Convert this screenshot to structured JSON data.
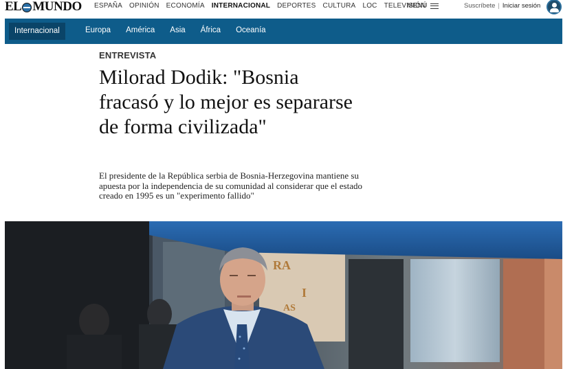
{
  "header": {
    "logo_left": "EL",
    "logo_right": "MUNDO",
    "nav": [
      "ESPAÑA",
      "OPINIÓN",
      "ECONOMÍA",
      "INTERNACIONAL",
      "DEPORTES",
      "CULTURA",
      "LOC",
      "TELEVISIÓN"
    ],
    "active_nav": "INTERNACIONAL",
    "menu_label": "MENÚ",
    "subscribe_label": "Suscríbete",
    "login_label": "Iniciar sesión"
  },
  "section": {
    "active": "Internacional",
    "items": [
      "Europa",
      "América",
      "Asia",
      "África",
      "Oceanía"
    ]
  },
  "article": {
    "kicker": "ENTREVISTA",
    "headline": "Milorad Dodik: \"Bosnia fracasó y lo mejor es separarse de forma civilizada\"",
    "standfirst": "El presidente de la República serbia de Bosnia-Herzegovina mantiene su apuesta por la independencia de su comunidad al considerar que el estado creado en 1995 es un \"experimento fallido\"",
    "photo_sign_text": [
      "RA",
      "I",
      "AS"
    ]
  },
  "colors": {
    "section_bar": "#0e5c8a",
    "section_active": "#0a4468",
    "awning": "#1e5a9c",
    "suit": "#2b4a78"
  }
}
